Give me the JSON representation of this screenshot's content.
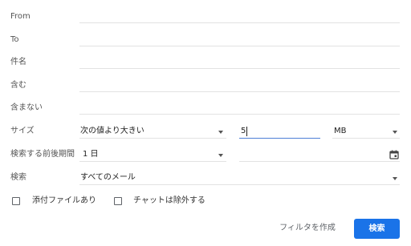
{
  "form": {
    "from": {
      "label": "From",
      "value": ""
    },
    "to": {
      "label": "To",
      "value": ""
    },
    "subject": {
      "label": "件名",
      "value": ""
    },
    "has_words": {
      "label": "含む",
      "value": ""
    },
    "no_words": {
      "label": "含まない",
      "value": ""
    },
    "size": {
      "label": "サイズ",
      "comparator": "次の値より大きい",
      "value": "5",
      "unit": "MB"
    },
    "date_within": {
      "label": "検索する前後期間",
      "value": "1 日",
      "date": ""
    },
    "search_in": {
      "label": "検索",
      "value": "すべてのメール"
    },
    "has_attachment": {
      "label": "添付ファイルあり",
      "checked": false
    },
    "exclude_chats": {
      "label": "チャットは除外する",
      "checked": false
    }
  },
  "actions": {
    "create_filter": "フィルタを作成",
    "search": "検索"
  },
  "colors": {
    "primary_button": "#1a73e8",
    "active_underline": "#4d7fd6"
  }
}
